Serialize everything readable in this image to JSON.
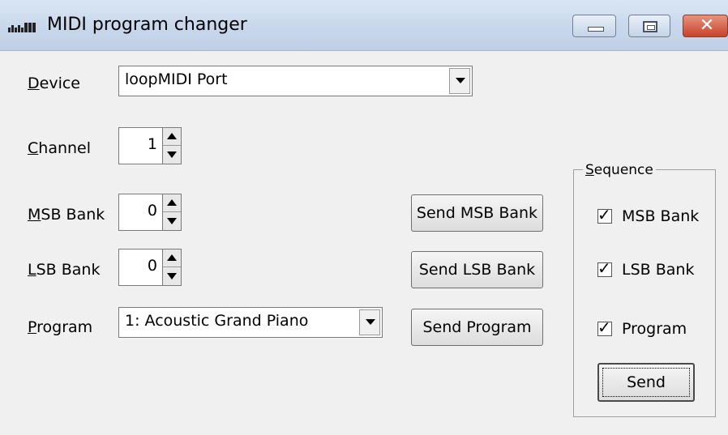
{
  "window": {
    "title": "MIDI program changer",
    "icon": "midi-keyboard-icon"
  },
  "captions": {
    "minimize": "minimize-icon",
    "maximize": "maximize-icon",
    "close": "✕"
  },
  "device": {
    "label": "Device",
    "value": "loopMIDI Port"
  },
  "channel": {
    "label": "Channel",
    "value": "1"
  },
  "msb": {
    "label": "MSB Bank",
    "value": "0",
    "send_label": "Send MSB Bank"
  },
  "lsb": {
    "label": "LSB Bank",
    "value": "0",
    "send_label": "Send LSB Bank"
  },
  "program": {
    "label": "Program",
    "value": "1: Acoustic Grand Piano",
    "send_label": "Send Program"
  },
  "sequence": {
    "title": "Sequence",
    "items": [
      {
        "label": "MSB Bank",
        "checked": true
      },
      {
        "label": "LSB Bank",
        "checked": true
      },
      {
        "label": "Program",
        "checked": true
      }
    ],
    "send_label": "Send"
  },
  "check_glyph": "✓"
}
